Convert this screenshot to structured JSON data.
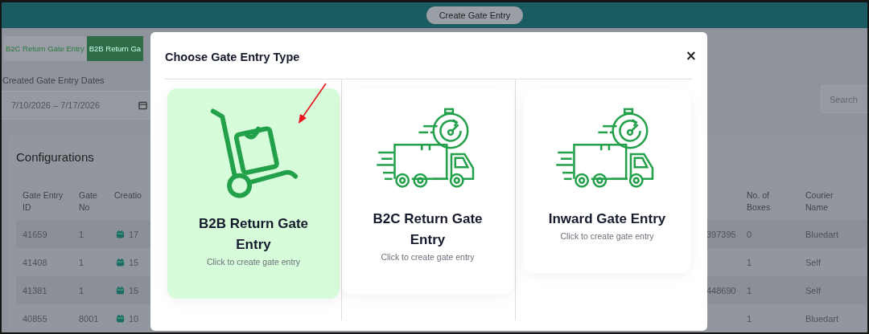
{
  "header": {
    "button": "Create Gate Entry"
  },
  "tabs": [
    {
      "label": "B2C Return Gate Entry",
      "selected": false
    },
    {
      "label": "B2B Return Ga",
      "selected": true
    }
  ],
  "date_filter": {
    "label": "Created Gate Entry Dates",
    "value": "7/10/2026 – 7/17/2026"
  },
  "search": {
    "placeholder": "Search"
  },
  "table": {
    "title": "Configurations",
    "columns": [
      "Gate Entry ID",
      "Gate No",
      "Creatio",
      "",
      "No. of Boxes",
      "Courier Name"
    ],
    "rows": [
      {
        "id": "41659",
        "gate_no": "1",
        "created": "17",
        "column_4": "397395",
        "boxes": "0",
        "courier": "Bluedart"
      },
      {
        "id": "41408",
        "gate_no": "1",
        "created": "15",
        "column_4": "",
        "boxes": "1",
        "courier": "Self"
      },
      {
        "id": "41381",
        "gate_no": "1",
        "created": "15",
        "column_4": "448690",
        "boxes": "1",
        "courier": "Self"
      },
      {
        "id": "40855",
        "gate_no": "8001",
        "created": "10",
        "column_4": "",
        "boxes": "1",
        "courier": "Bluedart"
      }
    ]
  },
  "modal": {
    "title": "Choose Gate Entry Type",
    "close": "×",
    "options": [
      {
        "title": "B2B Return Gate Entry",
        "subtitle": "Click to create gate entry",
        "kind": "trolley",
        "selected": true
      },
      {
        "title": "B2C Return Gate Entry",
        "subtitle": "Click to create gate entry",
        "kind": "truck",
        "selected": false
      },
      {
        "title": "Inward Gate Entry",
        "subtitle": "Click to create gate entry",
        "kind": "truck",
        "selected": false
      }
    ]
  }
}
